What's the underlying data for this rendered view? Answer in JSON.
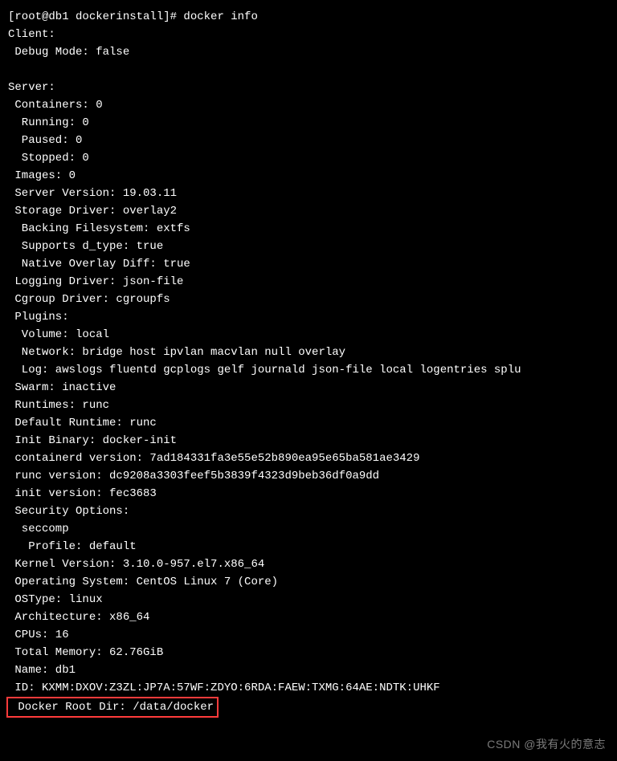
{
  "prompt": "[root@db1 dockerinstall]# docker info",
  "client": {
    "header": "Client:",
    "debug": " Debug Mode: false"
  },
  "server": {
    "header": "Server:",
    "containers": " Containers: 0",
    "running": "  Running: 0",
    "paused": "  Paused: 0",
    "stopped": "  Stopped: 0",
    "images": " Images: 0",
    "serverVersion": " Server Version: 19.03.11",
    "storageDriver": " Storage Driver: overlay2",
    "backingFs": "  Backing Filesystem: extfs",
    "supportsDtype": "  Supports d_type: true",
    "nativeOverlay": "  Native Overlay Diff: true",
    "loggingDriver": " Logging Driver: json-file",
    "cgroupDriver": " Cgroup Driver: cgroupfs",
    "plugins": " Plugins:",
    "volume": "  Volume: local",
    "network": "  Network: bridge host ipvlan macvlan null overlay",
    "log": "  Log: awslogs fluentd gcplogs gelf journald json-file local logentries splu",
    "swarm": " Swarm: inactive",
    "runtimes": " Runtimes: runc",
    "defaultRuntime": " Default Runtime: runc",
    "initBinary": " Init Binary: docker-init",
    "containerdVersion": " containerd version: 7ad184331fa3e55e52b890ea95e65ba581ae3429",
    "runcVersion": " runc version: dc9208a3303feef5b3839f4323d9beb36df0a9dd",
    "initVersion": " init version: fec3683",
    "securityOptions": " Security Options:",
    "seccomp": "  seccomp",
    "profile": "   Profile: default",
    "kernelVersion": " Kernel Version: 3.10.0-957.el7.x86_64",
    "os": " Operating System: CentOS Linux 7 (Core)",
    "osType": " OSType: linux",
    "architecture": " Architecture: x86_64",
    "cpus": " CPUs: 16",
    "totalMemory": " Total Memory: 62.76GiB",
    "name": " Name: db1",
    "id": " ID: KXMM:DXOV:Z3ZL:JP7A:57WF:ZDYO:6RDA:FAEW:TXMG:64AE:NDTK:UHKF",
    "dockerRootDir": " Docker Root Dir: /data/docker"
  },
  "watermark": "CSDN @我有火的意志"
}
